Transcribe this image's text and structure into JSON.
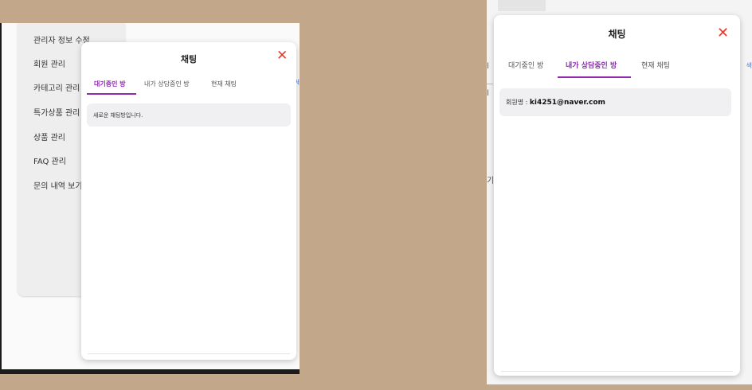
{
  "left": {
    "sidebar": {
      "items": [
        {
          "label": "관리자 정보 수정"
        },
        {
          "label": "회원 관리"
        },
        {
          "label": "카테고리 관리"
        },
        {
          "label": "특가상품 관리"
        },
        {
          "label": "상품 관리"
        },
        {
          "label": "FAQ 관리"
        },
        {
          "label": "문의 내역 보기"
        }
      ]
    },
    "bg_fragment": "세",
    "chat": {
      "title": "채팅",
      "close_icon": "close-icon",
      "tabs": [
        {
          "label": "대기중인 방",
          "active": true
        },
        {
          "label": "내가 상담중인 방",
          "active": false
        },
        {
          "label": "현재 채팅",
          "active": false
        }
      ],
      "rows": [
        {
          "text": "새로운 채팅방입니다."
        }
      ]
    }
  },
  "right": {
    "bg_fragments": [
      "l",
      "l",
      "l",
      "기"
    ],
    "bg_blue": "색",
    "chat": {
      "title": "채팅",
      "close_icon": "close-icon",
      "tabs": [
        {
          "label": "대기중인 방",
          "active": false
        },
        {
          "label": "내가 상담중인 방",
          "active": true
        },
        {
          "label": "현재 채팅",
          "active": false
        }
      ],
      "rows": [
        {
          "label": "회원명 : ",
          "value": "ki4251@naver.com"
        }
      ]
    }
  },
  "colors": {
    "background": "#c2a78a",
    "accent": "#8e2bb0",
    "close": "#e53b2e",
    "card": "#f0f0f2"
  }
}
